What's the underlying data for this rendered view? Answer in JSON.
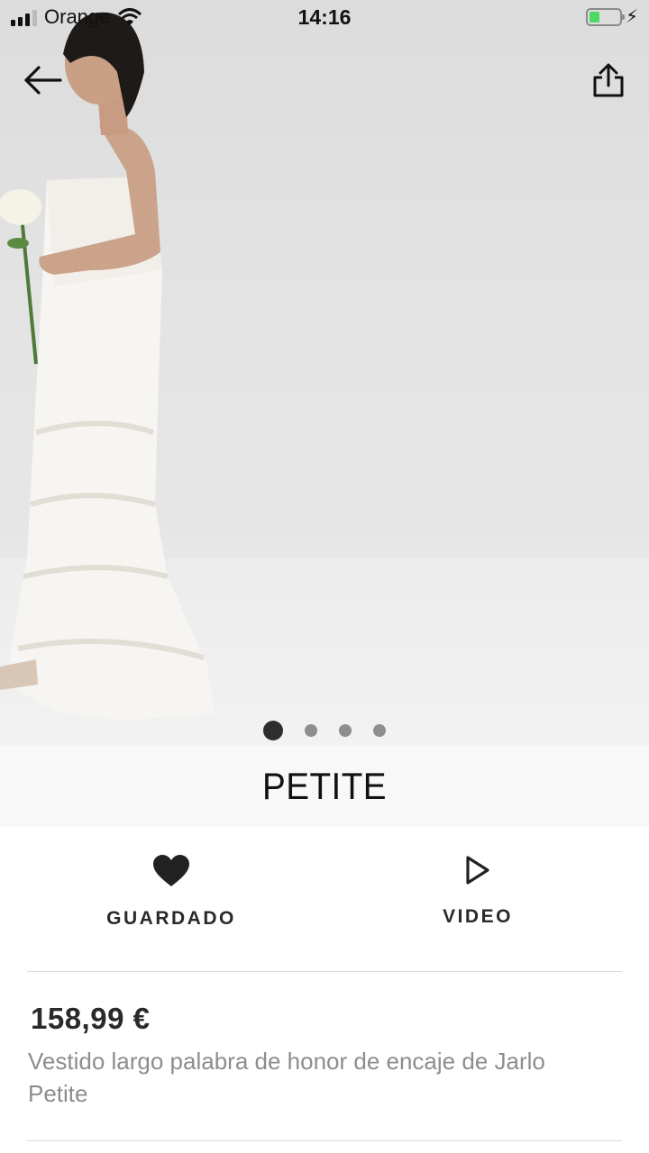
{
  "status_bar": {
    "carrier": "Orange",
    "time": "14:16"
  },
  "nav": {
    "back_icon": "arrow-left-icon",
    "share_icon": "share-icon"
  },
  "gallery": {
    "image_count": 4,
    "active_index": 0
  },
  "brand": {
    "name": "PETITE"
  },
  "actions": {
    "save": {
      "label": "GUARDADO",
      "icon": "heart-filled-icon"
    },
    "video": {
      "label": "VIDEO",
      "icon": "play-icon"
    }
  },
  "product": {
    "price": "158,99 €",
    "description": "Vestido largo palabra de honor de encaje de Jarlo Petite"
  },
  "colors": {
    "battery": "#4cd964",
    "text_dark": "#2a2a2a",
    "text_muted": "#8d8d8d"
  }
}
